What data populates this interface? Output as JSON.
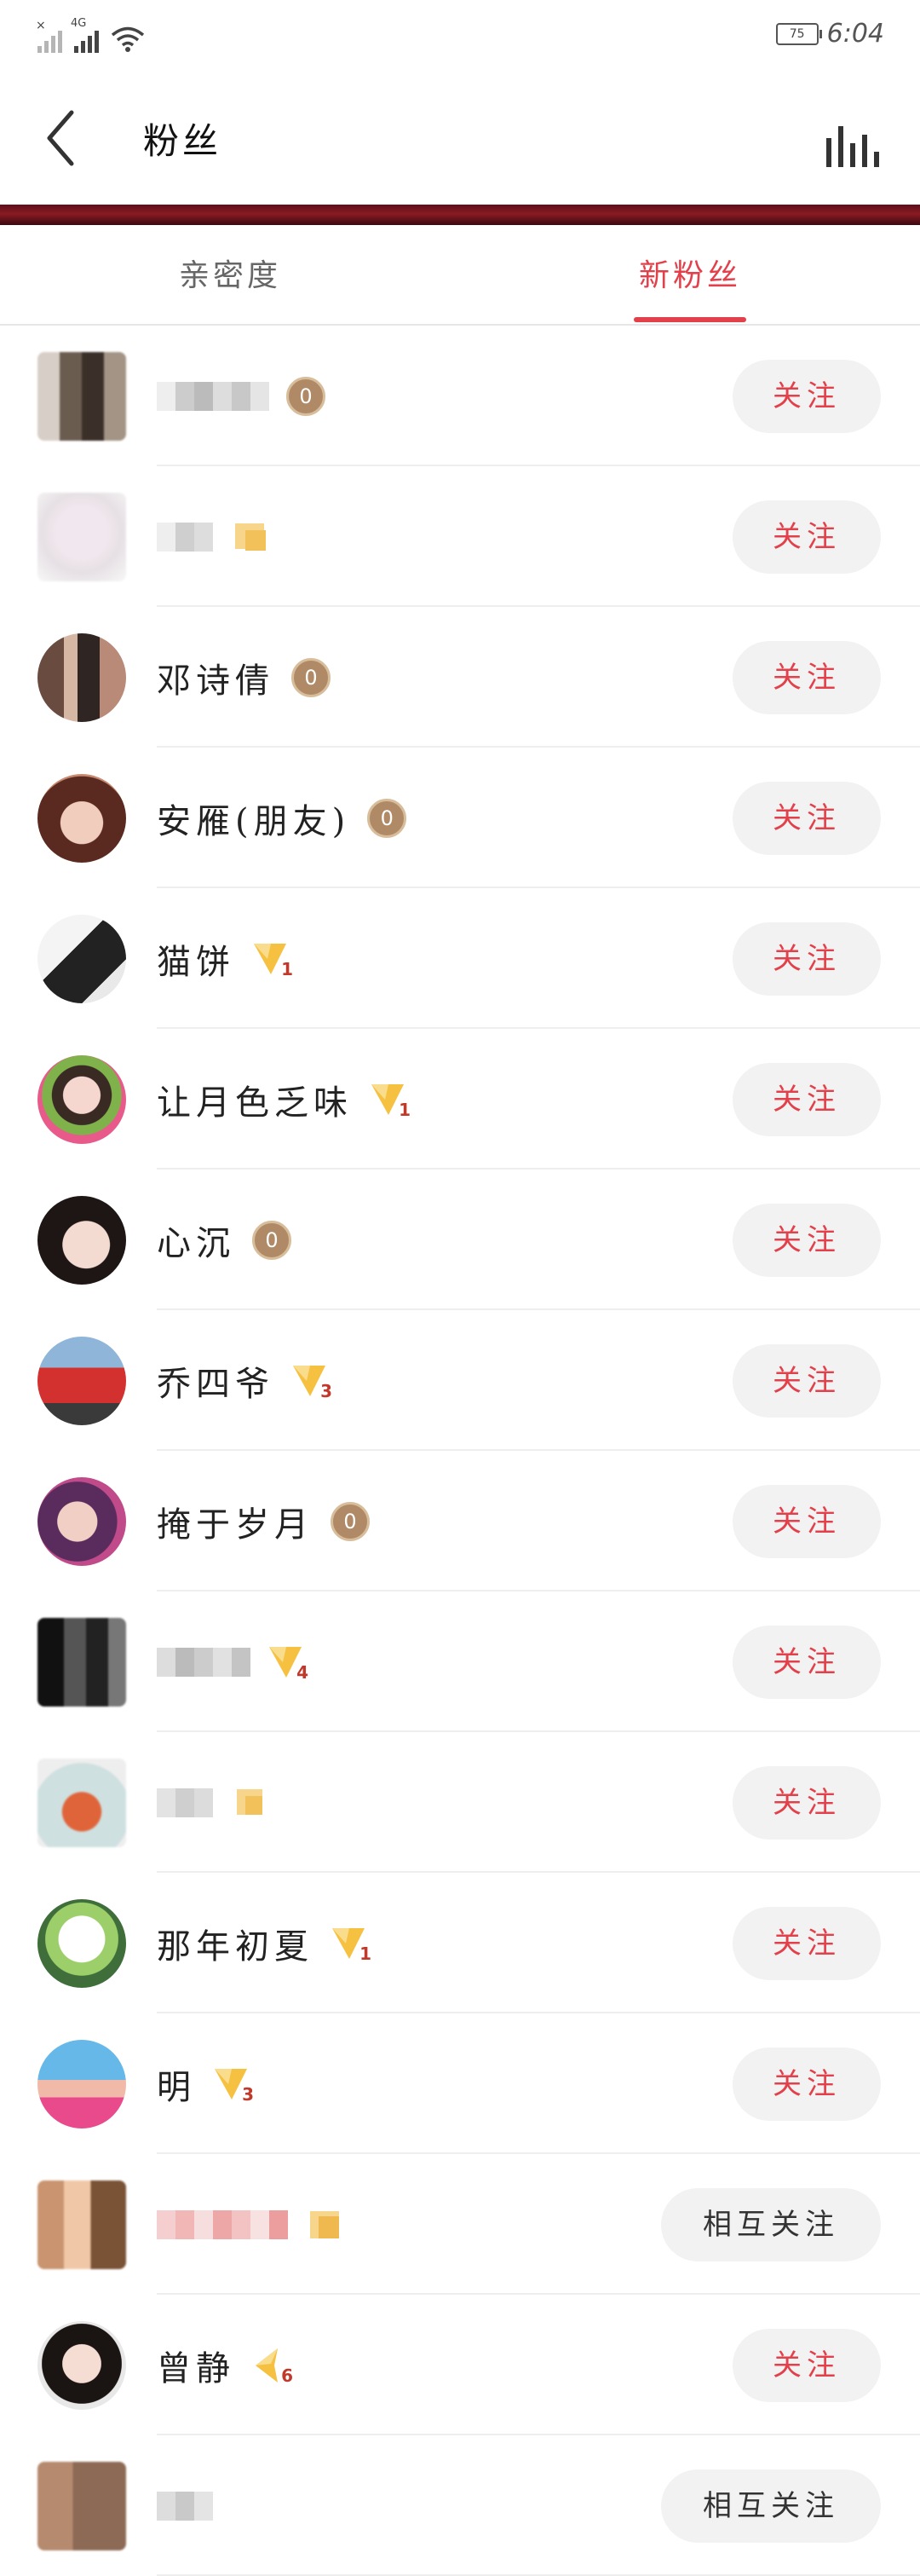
{
  "status_bar": {
    "net": "4G",
    "battery": "75",
    "time": "6:04"
  },
  "header": {
    "title": "粉丝"
  },
  "tabs": [
    {
      "label": "亲密度",
      "active": false
    },
    {
      "label": "新粉丝",
      "active": true
    }
  ],
  "accent_color": "#e2404a",
  "fans": [
    {
      "name": "",
      "level": "0",
      "badge": "coin",
      "button": "关注"
    },
    {
      "name": "",
      "level": "",
      "badge": "flag",
      "button": "关注"
    },
    {
      "name": "邓诗倩",
      "level": "0",
      "badge": "coin",
      "button": "关注"
    },
    {
      "name": "安雁(朋友)",
      "level": "0",
      "badge": "coin",
      "button": "关注"
    },
    {
      "name": "猫饼",
      "level": "1",
      "badge": "flag",
      "button": "关注"
    },
    {
      "name": "让月色乏味",
      "level": "1",
      "badge": "flag",
      "button": "关注"
    },
    {
      "name": "心沉",
      "level": "0",
      "badge": "coin",
      "button": "关注"
    },
    {
      "name": "乔四爷",
      "level": "3",
      "badge": "flag",
      "button": "关注"
    },
    {
      "name": "掩于岁月",
      "level": "0",
      "badge": "coin",
      "button": "关注"
    },
    {
      "name": "",
      "level": "4",
      "badge": "flag",
      "button": "关注"
    },
    {
      "name": "",
      "level": "",
      "badge": "flag",
      "button": "关注"
    },
    {
      "name": "那年初夏",
      "level": "1",
      "badge": "flag",
      "button": "关注"
    },
    {
      "name": "明",
      "level": "3",
      "badge": "flag",
      "button": "关注"
    },
    {
      "name": "",
      "level": "",
      "badge": "flag",
      "button": "相互关注"
    },
    {
      "name": "曾静",
      "level": "6",
      "badge": "flag",
      "button": "关注"
    },
    {
      "name": "",
      "level": "",
      "badge": "flag",
      "button": "相互关注"
    }
  ]
}
